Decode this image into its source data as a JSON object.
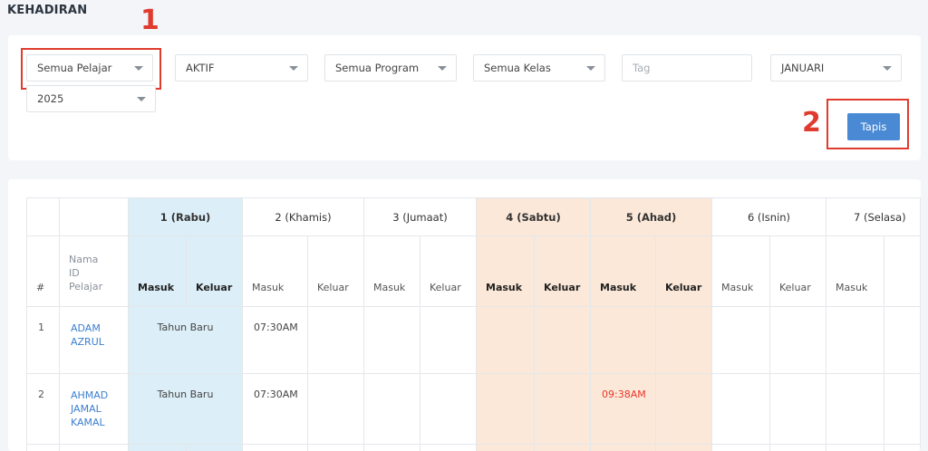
{
  "page_title": "KEHADIRAN",
  "filters": {
    "student": "Semua Pelajar",
    "status": "AKTIF",
    "program": "Semua Program",
    "class": "Semua Kelas",
    "tag_placeholder": "Tag",
    "month": "JANUARI",
    "year": "2025",
    "submit_label": "Tapis"
  },
  "callouts": {
    "one": "1",
    "two": "2"
  },
  "table": {
    "hash_label": "#",
    "name_header": [
      "Nama",
      "ID",
      "Pelajar"
    ],
    "days": [
      "1 (Rabu)",
      "2 (Khamis)",
      "3 (Jumaat)",
      "4 (Sabtu)",
      "5 (Ahad)",
      "6 (Isnin)",
      "7 (Selasa)"
    ],
    "in_label": "Masuk",
    "out_label": "Keluar",
    "rows": [
      {
        "num": "1",
        "name": [
          "ADAM",
          "AZRUL"
        ],
        "day1": "Tahun Baru",
        "d2_in": "07:30AM",
        "d5_in": ""
      },
      {
        "num": "2",
        "name": [
          "AHMAD",
          "JAMAL",
          "KAMAL"
        ],
        "day1": "Tahun Baru",
        "d2_in": "07:30AM",
        "d5_in": "09:38AM"
      }
    ]
  },
  "colors": {
    "accent": "#4a8ad4",
    "callout": "#e03b2f",
    "holiday_bg": "#dceef7",
    "weekend_bg": "#fbe8d8",
    "late": "#e8372b"
  }
}
